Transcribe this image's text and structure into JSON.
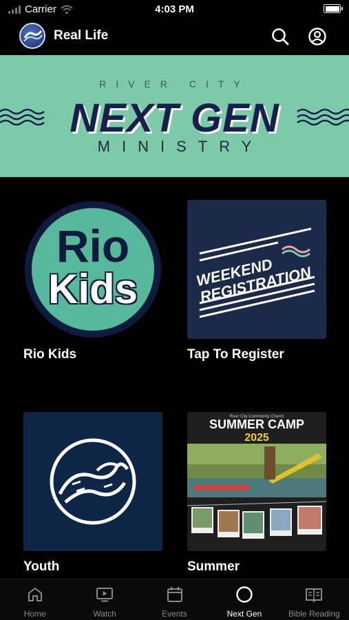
{
  "status_bar": {
    "carrier": "Carrier",
    "time": "4:03 PM",
    "battery_level": 1.0
  },
  "nav": {
    "title": "Real Life",
    "search_icon": "search-icon",
    "account_icon": "user-circle-icon"
  },
  "hero": {
    "line1": "RIVER CITY",
    "line2": "NEXT GEN",
    "line3": "MINISTRY"
  },
  "tiles": [
    {
      "label": "Rio Kids",
      "art_text_1": "Rio",
      "art_text_2": "Kids"
    },
    {
      "label": "Tap To Register",
      "art_text_1": "WEEKEND",
      "art_text_2": "REGISTRATION"
    },
    {
      "label": "Youth"
    },
    {
      "label": "Summer",
      "art_text_0": "River City Community Church",
      "art_text_1": "SUMMER CAMP",
      "art_text_2": "2025"
    }
  ],
  "tab_bar": {
    "items": [
      {
        "label": "Home",
        "icon": "home-icon"
      },
      {
        "label": "Watch",
        "icon": "tv-icon"
      },
      {
        "label": "Events",
        "icon": "calendar-icon"
      },
      {
        "label": "Next Gen",
        "icon": "circle-icon",
        "active": true
      },
      {
        "label": "Bible Reading",
        "icon": "book-icon"
      }
    ]
  },
  "colors": {
    "hero_bg": "#7ccaa9",
    "navy": "#16204a",
    "tab_active": "#ffffff",
    "tab_inactive": "#8a8a8a"
  }
}
